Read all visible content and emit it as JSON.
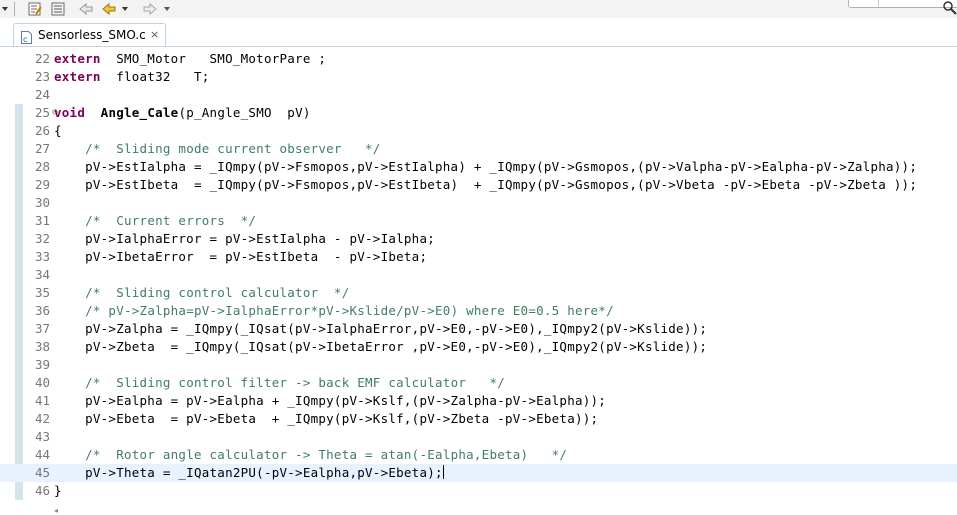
{
  "toolbar": {
    "icons": [
      "dropdown-arrow-icon",
      "toolbar-sep-icon",
      "edit-file-icon",
      "properties-icon",
      "last-edit-icon",
      "back-icon",
      "back-menu-icon",
      "forward-icon",
      "forward-menu-icon"
    ]
  },
  "tab": {
    "label": "Sensorless_SMO.c",
    "close": "×"
  },
  "colors": {
    "keyword": "#7f0055",
    "comment": "#3f7f5f",
    "line_number": "#787878",
    "current_line": "#e8f2fe",
    "change_ruler": "#d3e5ea"
  },
  "editor": {
    "lines": [
      {
        "n": "22",
        "fold": "",
        "segs": [
          {
            "t": "extern",
            "c": "kw"
          },
          {
            "t": "  SMO_Motor   SMO_MotorPare ;"
          }
        ]
      },
      {
        "n": "23",
        "fold": "",
        "segs": [
          {
            "t": "extern",
            "c": "kw"
          },
          {
            "t": "  float32   T;"
          }
        ]
      },
      {
        "n": "24",
        "fold": "",
        "segs": []
      },
      {
        "n": "25",
        "fold": "⊖",
        "segs": [
          {
            "t": "void",
            "c": "kw"
          },
          {
            "t": "  "
          },
          {
            "t": "Angle_Cale",
            "c": "fn"
          },
          {
            "t": "(p_Angle_SMO  pV)"
          }
        ]
      },
      {
        "n": "26",
        "fold": "",
        "segs": [
          {
            "t": "{"
          }
        ]
      },
      {
        "n": "27",
        "fold": "",
        "segs": [
          {
            "t": "    "
          },
          {
            "t": "/*  Sliding mode current observer   */",
            "c": "cm"
          }
        ]
      },
      {
        "n": "28",
        "fold": "",
        "segs": [
          {
            "t": "    pV->EstIalpha = _IQmpy(pV->Fsmopos,pV->EstIalpha) + _IQmpy(pV->Gsmopos,(pV->Valpha-pV->Ealpha-pV->Zalpha));"
          }
        ]
      },
      {
        "n": "29",
        "fold": "",
        "segs": [
          {
            "t": "    pV->EstIbeta  = _IQmpy(pV->Fsmopos,pV->EstIbeta)  + _IQmpy(pV->Gsmopos,(pV->Vbeta -pV->Ebeta -pV->Zbeta ));"
          }
        ]
      },
      {
        "n": "30",
        "fold": "",
        "segs": []
      },
      {
        "n": "31",
        "fold": "",
        "segs": [
          {
            "t": "    "
          },
          {
            "t": "/*  Current errors  */",
            "c": "cm"
          }
        ]
      },
      {
        "n": "32",
        "fold": "",
        "segs": [
          {
            "t": "    pV->IalphaError = pV->EstIalpha - pV->Ialpha;"
          }
        ]
      },
      {
        "n": "33",
        "fold": "",
        "segs": [
          {
            "t": "    pV->IbetaError  = pV->EstIbeta  - pV->Ibeta;"
          }
        ]
      },
      {
        "n": "34",
        "fold": "",
        "segs": []
      },
      {
        "n": "35",
        "fold": "",
        "segs": [
          {
            "t": "    "
          },
          {
            "t": "/*  Sliding control calculator  */",
            "c": "cm"
          }
        ]
      },
      {
        "n": "36",
        "fold": "",
        "segs": [
          {
            "t": "    "
          },
          {
            "t": "/* pV->Zalpha=pV->IalphaError*pV->Kslide/pV->E0) where E0=0.5 here*/",
            "c": "cm"
          }
        ]
      },
      {
        "n": "37",
        "fold": "",
        "segs": [
          {
            "t": "    pV->Zalpha = _IQmpy(_IQsat(pV->IalphaError,pV->E0,-pV->E0),_IQmpy2(pV->Kslide));"
          }
        ]
      },
      {
        "n": "38",
        "fold": "",
        "segs": [
          {
            "t": "    pV->Zbeta  = _IQmpy(_IQsat(pV->IbetaError ,pV->E0,-pV->E0),_IQmpy2(pV->Kslide));"
          }
        ]
      },
      {
        "n": "39",
        "fold": "",
        "segs": []
      },
      {
        "n": "40",
        "fold": "",
        "segs": [
          {
            "t": "    "
          },
          {
            "t": "/*  Sliding control filter -> back EMF calculator   */",
            "c": "cm"
          }
        ]
      },
      {
        "n": "41",
        "fold": "",
        "segs": [
          {
            "t": "    pV->Ealpha = pV->Ealpha + _IQmpy(pV->Kslf,(pV->Zalpha-pV->Ealpha));"
          }
        ]
      },
      {
        "n": "42",
        "fold": "",
        "segs": [
          {
            "t": "    pV->Ebeta  = pV->Ebeta  + _IQmpy(pV->Kslf,(pV->Zbeta -pV->Ebeta));"
          }
        ]
      },
      {
        "n": "43",
        "fold": "",
        "segs": []
      },
      {
        "n": "44",
        "fold": "",
        "segs": [
          {
            "t": "    "
          },
          {
            "t": "/*  Rotor angle calculator -> Theta = atan(-Ealpha,Ebeta)   */",
            "c": "cm"
          }
        ]
      },
      {
        "n": "45",
        "fold": "",
        "current": true,
        "segs": [
          {
            "t": "    pV->Theta = _IQatan2PU(-pV->Ealpha,pV->Ebeta);"
          }
        ]
      },
      {
        "n": "46",
        "fold": "",
        "segs": [
          {
            "t": "}"
          }
        ]
      }
    ]
  }
}
